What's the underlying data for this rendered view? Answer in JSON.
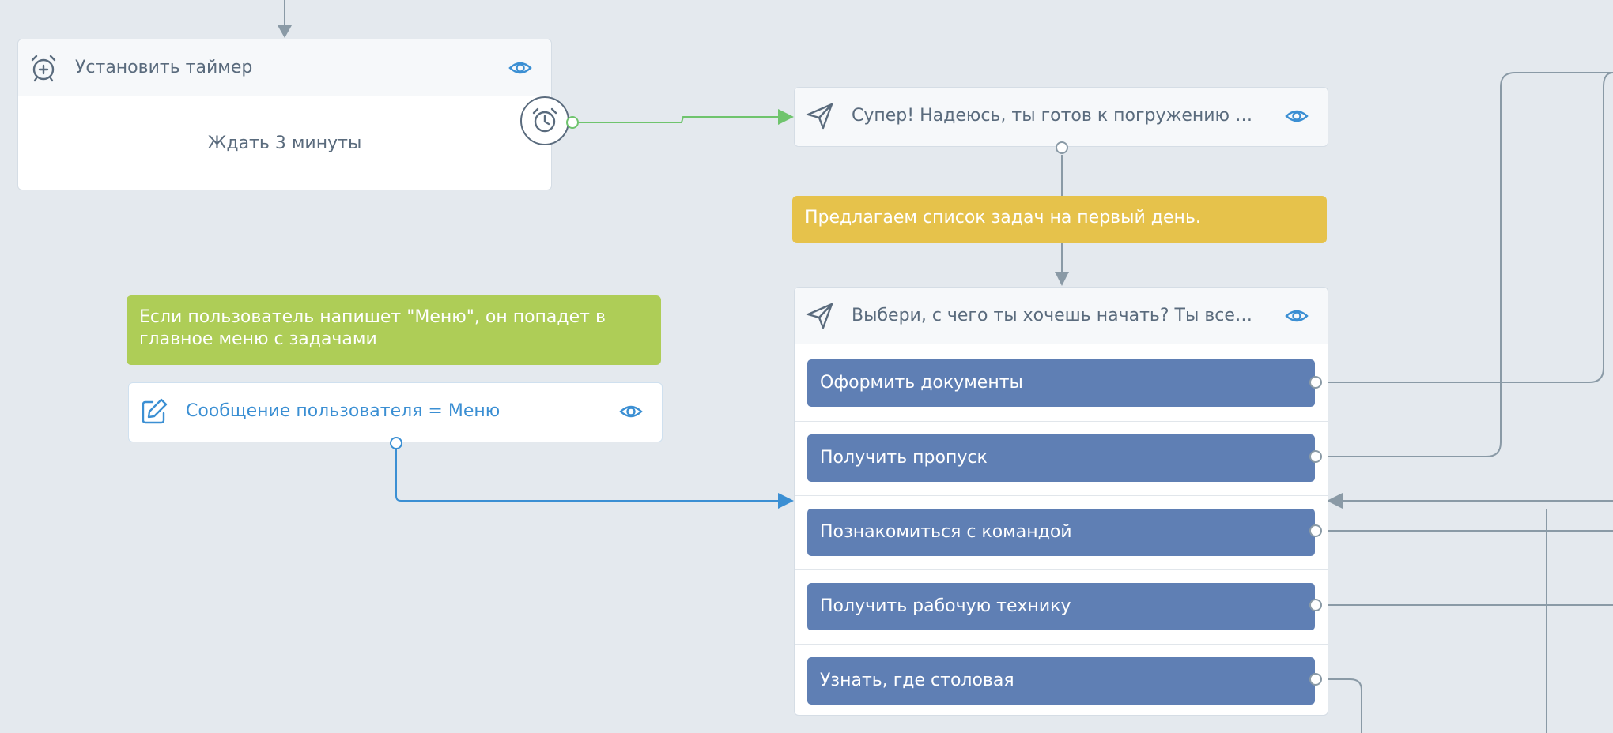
{
  "colors": {
    "canvas_bg": "#e4e9ee",
    "wire_gray": "#8a9aa6",
    "wire_green": "#6fc46d",
    "wire_blue": "#3b8fd3",
    "button_blue": "#5f7fb4",
    "note_yellow": "#e6c24b",
    "note_green": "#aecd57"
  },
  "timer_node": {
    "icon": "alarm-plus-icon",
    "title": "Установить таймер",
    "body": "Ждать 3 минуты",
    "badge_icon": "alarm-clock-icon"
  },
  "message_node_1": {
    "icon": "send-icon",
    "title": "Супер! Надеюсь, ты готов к погружению в…"
  },
  "yellow_note": {
    "text": "Предлагаем список задач на первый день."
  },
  "green_note": {
    "text": "Если пользователь напишет \"Меню\", он попадет в главное меню с задачами"
  },
  "condition_node": {
    "icon": "edit-icon",
    "title": "Сообщение пользователя = Меню"
  },
  "menu_node": {
    "icon": "send-icon",
    "title": "Выбери, с чего ты хочешь начать? Ты всегда…",
    "buttons": [
      {
        "label": "Оформить документы"
      },
      {
        "label": "Получить пропуск"
      },
      {
        "label": "Познакомиться с командой"
      },
      {
        "label": "Получить рабочую технику"
      },
      {
        "label": "Узнать, где столовая"
      }
    ]
  }
}
